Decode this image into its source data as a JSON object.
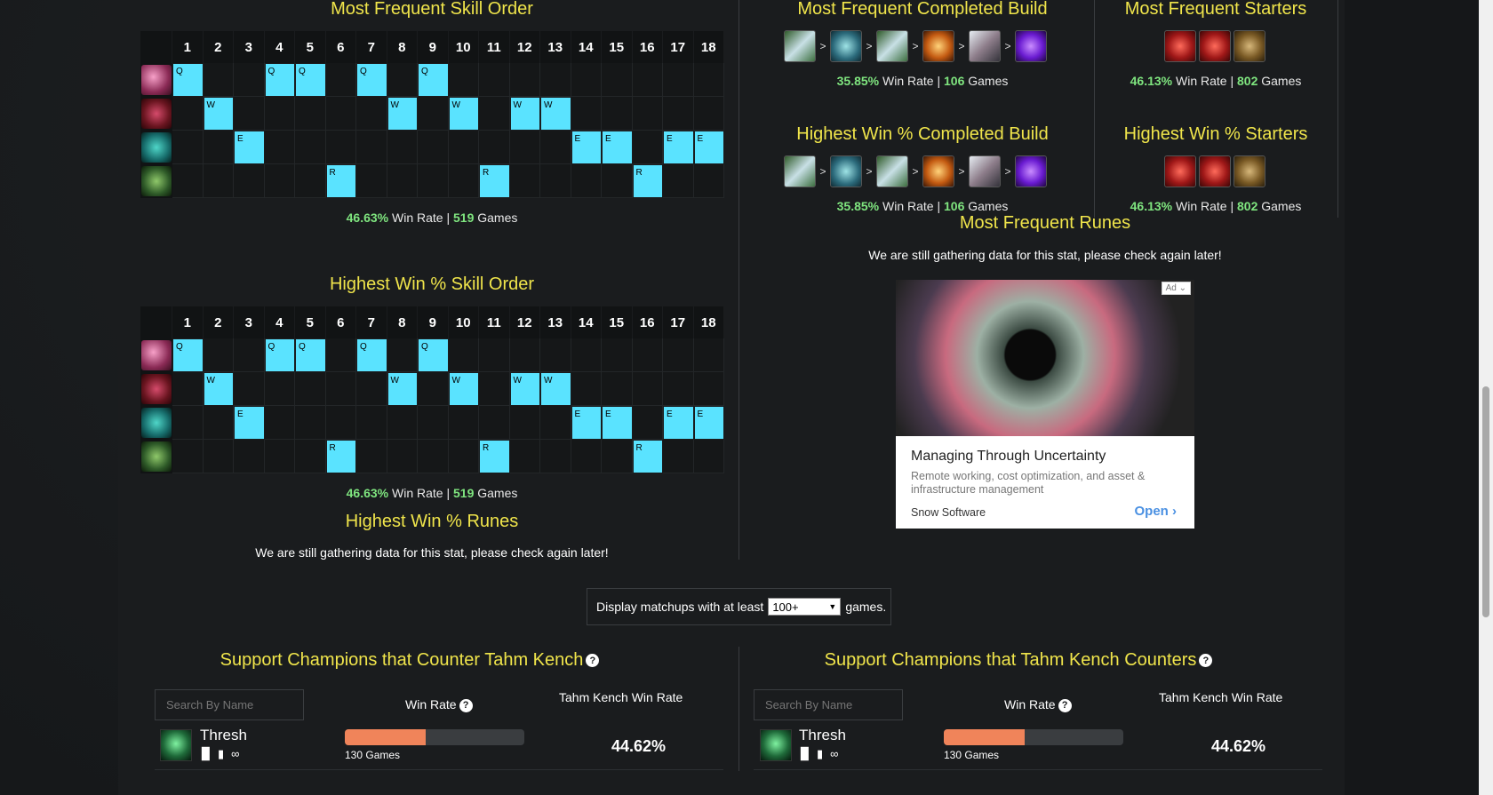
{
  "skill_order_frequent": {
    "title": "Most Frequent Skill Order",
    "levels": [
      "1",
      "2",
      "3",
      "4",
      "5",
      "6",
      "7",
      "8",
      "9",
      "10",
      "11",
      "12",
      "13",
      "14",
      "15",
      "16",
      "17",
      "18"
    ],
    "abilities": [
      {
        "key": "Q",
        "icon": "ability-q-icon",
        "levels": [
          1,
          4,
          5,
          7,
          9
        ]
      },
      {
        "key": "W",
        "icon": "ability-w-icon",
        "levels": [
          2,
          8,
          10,
          12,
          13
        ]
      },
      {
        "key": "E",
        "icon": "ability-e-icon",
        "levels": [
          3,
          14,
          15,
          17,
          18
        ]
      },
      {
        "key": "R",
        "icon": "ability-r-icon",
        "levels": [
          6,
          11,
          16
        ]
      }
    ],
    "win_rate": "46.63%",
    "wr_label": "Win Rate |",
    "games": "519",
    "games_label": "Games"
  },
  "skill_order_highest": {
    "title": "Highest Win % Skill Order",
    "win_rate": "46.63%",
    "wr_label": "Win Rate |",
    "games": "519",
    "games_label": "Games"
  },
  "runes_highest": {
    "title": "Highest Win % Runes",
    "message": "We are still gathering data for this stat, please check again later!"
  },
  "build_frequent": {
    "title": "Most Frequent Completed Build",
    "items": [
      "boots-icon",
      "warden-icon",
      "boots-icon",
      "locket-icon",
      "sword-icon",
      "purple-shield-icon"
    ],
    "arrow": ">",
    "win_rate": "35.85%",
    "wr_label": "Win Rate |",
    "games": "106",
    "games_label": "Games"
  },
  "build_highest": {
    "title": "Highest Win % Completed Build",
    "win_rate": "35.85%",
    "wr_label": "Win Rate |",
    "games": "106",
    "games_label": "Games"
  },
  "starters_frequent": {
    "title": "Most Frequent Starters",
    "items": [
      "potion-icon",
      "potion-icon",
      "relic-icon"
    ],
    "win_rate": "46.13%",
    "wr_label": "Win Rate |",
    "games": "802",
    "games_label": "Games"
  },
  "starters_highest": {
    "title": "Highest Win % Starters",
    "win_rate": "46.13%",
    "wr_label": "Win Rate |",
    "games": "802",
    "games_label": "Games"
  },
  "runes_frequent": {
    "title": "Most Frequent Runes",
    "message": "We are still gathering data for this stat, please check again later!"
  },
  "ad": {
    "badge": "Ad",
    "title": "Managing Through Uncertainty",
    "description": "Remote working, cost optimization, and asset & infrastructure management",
    "brand": "Snow Software",
    "cta": "Open"
  },
  "matchup_filter": {
    "prefix": "Display matchups with at least",
    "selected": "100+",
    "suffix": "games."
  },
  "counters_left": {
    "title": "Support Champions that Counter Tahm Kench",
    "search_placeholder": "Search By Name",
    "col_winrate": "Win Rate",
    "col_tk_winrate": "Tahm Kench Win Rate",
    "row": {
      "name": "Thresh",
      "games": "130 Games",
      "games_fraction": 0.45,
      "tk_win_rate": "44.62%"
    }
  },
  "counters_right": {
    "title": "Support Champions that Tahm Kench Counters",
    "search_placeholder": "Search By Name",
    "col_winrate": "Win Rate",
    "col_tk_winrate": "Tahm Kench Win Rate",
    "row": {
      "name": "Thresh",
      "games": "130 Games",
      "games_fraction": 0.45,
      "tk_win_rate": "44.62%"
    }
  },
  "colors": {
    "title": "#f0e54b",
    "skill_on": "#5ae3ff",
    "winrate": "#7fe57f",
    "bar": "#f0845a"
  }
}
